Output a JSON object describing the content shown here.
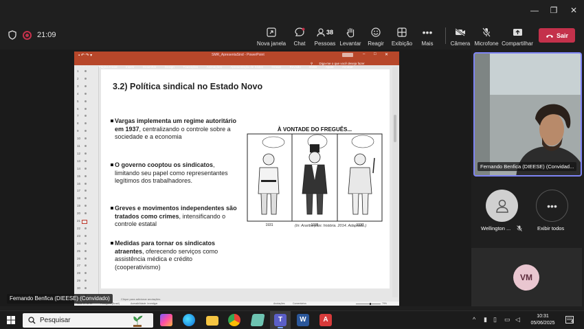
{
  "window_controls": {
    "minimize": "—",
    "maximize": "❐",
    "close": "✕"
  },
  "meeting": {
    "timer": "21:09",
    "toolbar": {
      "new_window": "Nova janela",
      "chat": "Chat",
      "people": "Pessoas",
      "people_count": "38",
      "raise": "Levantar",
      "react": "Reagir",
      "view": "Exibição",
      "more": "Mais",
      "camera": "Câmera",
      "mic": "Microfone",
      "share": "Compartilhar",
      "leave": "Sair"
    }
  },
  "powerpoint": {
    "titlebar_doc": "SMR_ApresentaSind - PowerPoint",
    "ribbon_tabs": [
      "Arquivo",
      "Página Inicial",
      "Inserir",
      "Desenhar",
      "Design",
      "Transições",
      "Animações",
      "Apresentação de Slides",
      "Gravar",
      "Revisão",
      "Exibir",
      "Ajuda",
      "Acrobat"
    ],
    "tell_me": "Diga-me o que você deseja fazer",
    "ruler_numbers": [
      "1",
      "2",
      "3",
      "4",
      "5",
      "6",
      "7",
      "8",
      "9",
      "10",
      "11",
      "12",
      "13",
      "14",
      "15",
      "16",
      "17",
      "18",
      "19",
      "20",
      "21",
      "22",
      "23",
      "24",
      "25",
      "26",
      "27",
      "28",
      "29",
      "30",
      "31"
    ],
    "notes_placeholder": "Clique para adicionar anotações",
    "status": {
      "slide": "Slide 21 de 49",
      "lang": "Português (Brasil)",
      "accessibility": "Acessibilidade: Investigar",
      "notes": "Anotações",
      "comments": "Comentários",
      "zoom": "79%"
    },
    "slide": {
      "title": "3.2) Política sindical no Estado Novo",
      "bullets": [
        {
          "bold": "Vargas implementa um regime autoritário em 1937",
          "rest": ", centralizando o controle sobre a sociedade e a economia"
        },
        {
          "bold": "O governo cooptou os sindicatos",
          "rest": ", limitando seu papel como representantes legítimos dos trabalhadores."
        },
        {
          "bold": "Greves e movimentos independentes são tratados como crimes",
          "rest": ", intensificando o controle estatal"
        },
        {
          "bold": "Medidas para tornar os sindicatos atraentes",
          "rest": ", oferecendo serviços como assistência médica e crédito (cooperativismo)"
        }
      ],
      "cartoon": {
        "title": "À VONTADE DO FREGUÊS...",
        "years": [
          "1931",
          "1935",
          "1937"
        ],
        "caption": "(In: Arariba plus: história. 2014. Adaptado.)"
      }
    }
  },
  "presenter_label": "Fernando Benfica (DIEESE) (Convidado)",
  "video_label": "Fernando Benfica (DIEESE) (Convidad...",
  "participants": {
    "wellington": "Wellington ...",
    "view_all": "Exibir todos",
    "vm_initials": "VM"
  },
  "taskbar": {
    "search_placeholder": "Pesquisar",
    "time": "10:31",
    "date": "05/06/2025",
    "notification_count": "4"
  },
  "colors": {
    "accent": "#7f85f5",
    "leave": "#c4314b",
    "ppt": "#b7472a"
  }
}
